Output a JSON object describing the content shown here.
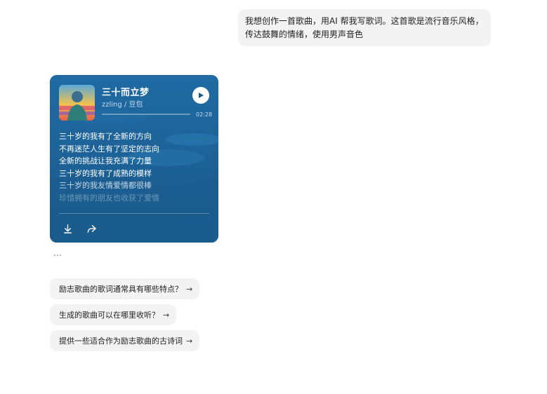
{
  "user_message": {
    "text": "我想创作一首歌曲，用AI 帮我写歌词。这首歌是流行音乐风格，传达鼓舞的情绪，使用男声音色"
  },
  "song_card": {
    "title": "三十而立梦",
    "author": "zzling / 豆包",
    "duration": "02:28",
    "progress_fraction": 0.0,
    "lyrics": [
      "三十岁的我有了全新的方向",
      "不再迷茫人生有了坚定的志向",
      "全新的挑战让我充满了力量",
      "三十岁的我有了成熟的模样",
      "三十岁的我友情爱情都很棒",
      "珍惜拥有的朋友也收获了爱情"
    ],
    "colors": {
      "background": "#1a5a8c",
      "accent": "#ffffff"
    },
    "icons": {
      "play": "play-icon",
      "download": "download-icon",
      "share": "share-icon"
    }
  },
  "more_indicator": "…",
  "suggestions": [
    {
      "text": "励志歌曲的歌词通常具有哪些特点？",
      "arrow": "→"
    },
    {
      "text": "生成的歌曲可以在哪里收听？",
      "arrow": "→"
    },
    {
      "text": "提供一些适合作为励志歌曲的古诗词",
      "arrow": "→"
    }
  ]
}
